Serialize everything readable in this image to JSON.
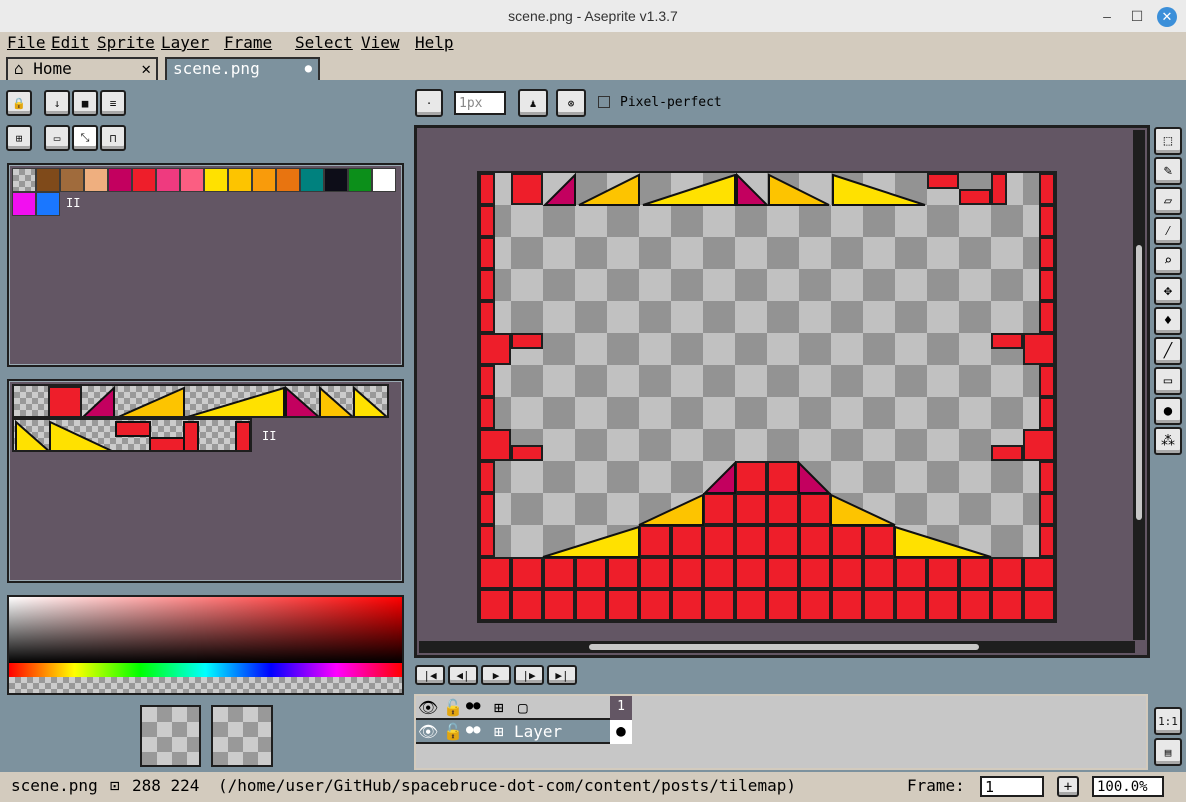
{
  "window": {
    "title": "scene.png - Aseprite v1.3.7",
    "minimize": "–",
    "maximize": "☐",
    "close": "✕"
  },
  "menu": [
    "File",
    "Edit",
    "Sprite",
    "Layer",
    "Frame",
    "Select",
    "View",
    "Help"
  ],
  "tabs": [
    {
      "label": "Home",
      "close": "✕"
    },
    {
      "label": "scene.png",
      "dot": "●"
    }
  ],
  "toolbar": {
    "brush_size": "1px",
    "pixel_perfect": "Pixel-perfect"
  },
  "palette": {
    "colors": [
      "#7f4a1a",
      "#a06b3c",
      "#efaf7f",
      "#c3005f",
      "#ee1e2a",
      "#ef3a7f",
      "#fb5e82",
      "#ffe100",
      "#fdc400",
      "#f99b0b",
      "#e87410",
      "#00817e",
      "#0d0d18",
      "#0c8f1a",
      "#ffffff",
      "#f20ff0",
      "#1a77ff"
    ],
    "more": "II"
  },
  "tileset": {
    "more": "II"
  },
  "frames": {
    "frame_label": "Frame:",
    "frame_value": "1",
    "zoom": "100.0%",
    "plus": "+"
  },
  "timeline": {
    "frame_number": "1",
    "layer_name": "Layer",
    "zoom_fit": "1:1"
  },
  "status": {
    "filename": "scene.png",
    "dims": "288 224",
    "path": "(/home/user/GitHub/spacebruce-dot-com/content/posts/tilemap)"
  },
  "colors": {
    "accent": "#ee1e2a",
    "panel": "#635664",
    "bg": "#7d929e"
  }
}
